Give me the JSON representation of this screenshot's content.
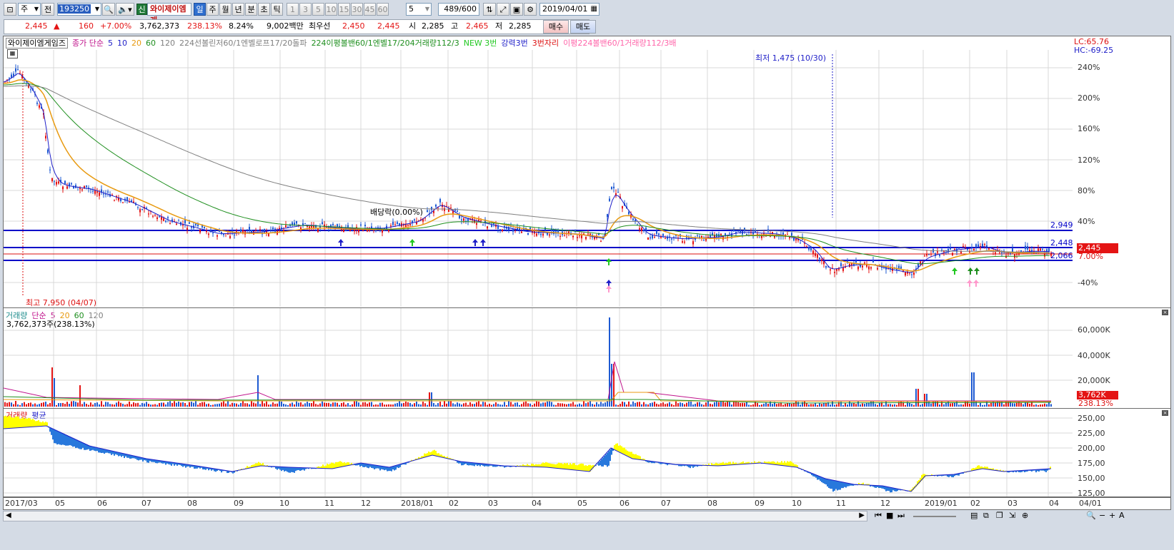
{
  "toolbar": {
    "mode_box": "주",
    "prev_label": "전",
    "stock_code": "193250",
    "new_badge": "신",
    "stock_name": "와이제이엠게",
    "periods": [
      "일",
      "주",
      "월",
      "년",
      "분",
      "초",
      "틱"
    ],
    "active_period": "일",
    "intervals": [
      "1",
      "3",
      "5",
      "10",
      "15",
      "30",
      "45",
      "60"
    ],
    "interval_value": "5",
    "count": "489/600",
    "date": "2019/04/01"
  },
  "quote": {
    "price": "2,445",
    "direction": "▲",
    "change": "160",
    "change_pct": "+7.00%",
    "volume": "3,762,373",
    "vol_ratio": "238.13%",
    "turnover_pct": "8.24%",
    "amount": "9,002백만",
    "priority_label": "최우선",
    "bid1": "2,450",
    "bid2": "2,445",
    "open_label": "시",
    "open": "2,285",
    "high_label": "고",
    "high": "2,465",
    "low_label": "저",
    "low": "2,285",
    "buy": "매수",
    "sell": "매도"
  },
  "price_panel": {
    "legend": [
      {
        "text": "와이제이엠게임즈",
        "color": "#000000"
      },
      {
        "text": "종가 단순",
        "color": "#c0148c"
      },
      {
        "text": "5",
        "color": "#1e1ec8"
      },
      {
        "text": "10",
        "color": "#1e1ec8"
      },
      {
        "text": "20",
        "color": "#e89a10"
      },
      {
        "text": "60",
        "color": "#1f8f1f"
      },
      {
        "text": "120",
        "color": "#808080"
      },
      {
        "text": "224선볼린저60/1엔벨로프17/20돌파",
        "color": "#808080"
      },
      {
        "text": "224이평볼밴60/1엔벨17/204거래량112/3",
        "color": "#1f8f1f"
      },
      {
        "text": "NEW 3번",
        "color": "#22c822"
      },
      {
        "text": "강력3번",
        "color": "#1e1ec8"
      },
      {
        "text": "3번자리",
        "color": "#dd1010"
      },
      {
        "text": "이평224볼밴60/1거래량112/3배",
        "color": "#ff66aa"
      }
    ],
    "lc_hc": [
      "LC:65.76",
      "HC:-69.25"
    ],
    "y_labels": [
      "240%",
      "200%",
      "160%",
      "120%",
      "80%",
      "40%",
      "-40%"
    ],
    "h_lines": [
      "2,949",
      "2,448",
      "2,066"
    ],
    "current_price": "2,445",
    "current_pct": "7.00%",
    "annotation_low": "최저 1,475 (10/30)",
    "annotation_high": "최고 7,950 (04/07)",
    "annotation_div": "배당락(0.00%)"
  },
  "volume_panel": {
    "legend": [
      {
        "text": "거래량",
        "color": "#1e8c8c"
      },
      {
        "text": "단순",
        "color": "#c0148c"
      },
      {
        "text": "5",
        "color": "#c0148c"
      },
      {
        "text": "20",
        "color": "#e89a10"
      },
      {
        "text": "60",
        "color": "#1f8f1f"
      },
      {
        "text": "120",
        "color": "#808080"
      }
    ],
    "subtitle": "3,762,373주(238.13%)",
    "y_labels": [
      "60,000K",
      "40,000K",
      "20,000K"
    ],
    "current": "3,762K",
    "current_pct": "238.13%"
  },
  "avg_panel": {
    "legend": [
      {
        "text": "거래량",
        "color": "#dd1010"
      },
      {
        "text": "평균",
        "color": "#1e1ec8"
      }
    ],
    "y_labels": [
      "250,00",
      "225,00",
      "200,00",
      "175,00",
      "150,00",
      "125,00"
    ]
  },
  "x_axis": [
    "2017/03",
    "05",
    "06",
    "07",
    "08",
    "09",
    "10",
    "11",
    "12",
    "2018/01",
    "02",
    "03",
    "04",
    "05",
    "06",
    "07",
    "08",
    "09",
    "10",
    "11",
    "12",
    "2019/01",
    "02",
    "03",
    "04",
    "04/01"
  ],
  "colors": {
    "up": "#e41414",
    "down": "#1e5ad2",
    "hline": "#0000c8",
    "avg_pos": "#ffff00",
    "avg_neg": "#2878dc"
  }
}
